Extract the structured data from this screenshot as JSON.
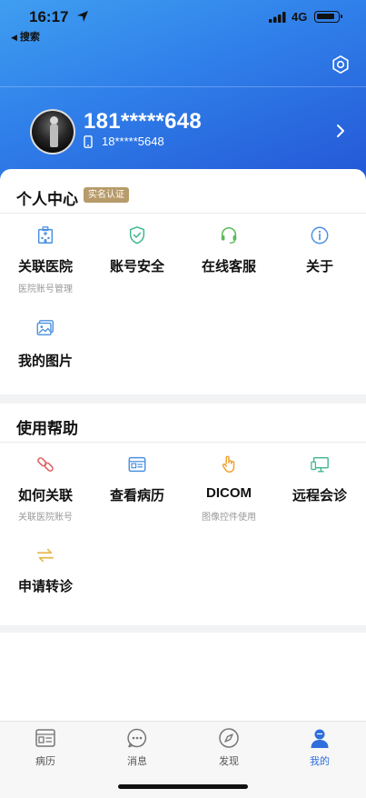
{
  "status_bar": {
    "time": "16:17",
    "back_label": "搜索",
    "network": "4G"
  },
  "profile": {
    "username": "181*****648",
    "phone": "18*****5648"
  },
  "personal_center": {
    "title": "个人中心",
    "badge": "实名认证",
    "items": [
      {
        "label": "关联医院",
        "sub": "医院账号管理",
        "icon": "hospital-icon"
      },
      {
        "label": "账号安全",
        "sub": "",
        "icon": "shield-check-icon"
      },
      {
        "label": "在线客服",
        "sub": "",
        "icon": "headset-icon"
      },
      {
        "label": "关于",
        "sub": "",
        "icon": "info-icon"
      },
      {
        "label": "我的图片",
        "sub": "",
        "icon": "image-icon"
      }
    ]
  },
  "help": {
    "title": "使用帮助",
    "items": [
      {
        "label": "如何关联",
        "sub": "关联医院账号",
        "icon": "link-icon"
      },
      {
        "label": "查看病历",
        "sub": "",
        "icon": "record-card-icon"
      },
      {
        "label": "DICOM",
        "sub": "图像控件使用",
        "icon": "pointer-hand-icon"
      },
      {
        "label": "远程会诊",
        "sub": "",
        "icon": "monitor-icon"
      },
      {
        "label": "申请转诊",
        "sub": "",
        "icon": "transfer-arrows-icon"
      }
    ]
  },
  "tabbar": {
    "tabs": [
      {
        "label": "病历",
        "icon": "record-icon"
      },
      {
        "label": "消息",
        "icon": "chat-icon"
      },
      {
        "label": "发现",
        "icon": "compass-icon"
      },
      {
        "label": "我的",
        "icon": "user-icon",
        "active": true
      }
    ]
  },
  "colors": {
    "header_start": "#3f9ef0",
    "header_end": "#2457d6",
    "badge": "#b89b6b",
    "active_tab": "#2f6fdc"
  }
}
